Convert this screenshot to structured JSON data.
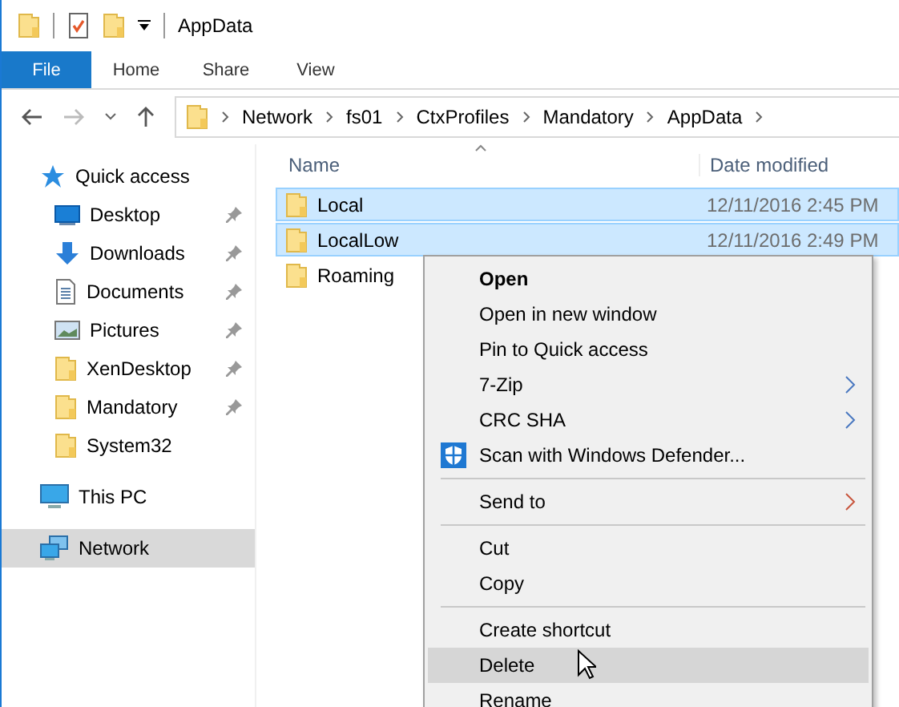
{
  "window": {
    "title": "AppData"
  },
  "ribbon_tabs": [
    {
      "label": "File",
      "selected": true
    },
    {
      "label": "Home",
      "selected": false
    },
    {
      "label": "Share",
      "selected": false
    },
    {
      "label": "View",
      "selected": false
    }
  ],
  "address_bar": {
    "path": [
      "Network",
      "fs01",
      "CtxProfiles",
      "Mandatory",
      "AppData"
    ]
  },
  "sidebar": {
    "items": [
      {
        "label": "Quick access",
        "kind": "star",
        "pinned": false,
        "selected": false
      },
      {
        "label": "Desktop",
        "kind": "desktop",
        "pinned": true,
        "selected": false
      },
      {
        "label": "Downloads",
        "kind": "download",
        "pinned": true,
        "selected": false
      },
      {
        "label": "Documents",
        "kind": "document",
        "pinned": true,
        "selected": false
      },
      {
        "label": "Pictures",
        "kind": "pictures",
        "pinned": true,
        "selected": false
      },
      {
        "label": "XenDesktop",
        "kind": "folder",
        "pinned": true,
        "selected": false
      },
      {
        "label": "Mandatory",
        "kind": "folder",
        "pinned": true,
        "selected": false
      },
      {
        "label": "System32",
        "kind": "folder",
        "pinned": false,
        "selected": false
      },
      {
        "label": "This PC",
        "kind": "pc",
        "pinned": false,
        "selected": false
      },
      {
        "label": "Network",
        "kind": "network",
        "pinned": false,
        "selected": true
      }
    ]
  },
  "file_list": {
    "columns": [
      "Name",
      "Date modified"
    ],
    "rows": [
      {
        "name": "Local",
        "date": "12/11/2016 2:45 PM",
        "selected": true
      },
      {
        "name": "LocalLow",
        "date": "12/11/2016 2:49 PM",
        "selected": true
      },
      {
        "name": "Roaming",
        "selected": false
      }
    ]
  },
  "context_menu": {
    "items": [
      {
        "kind": "item",
        "label": "Open",
        "default": true,
        "submenu": false,
        "selected": false
      },
      {
        "kind": "item",
        "label": "Open in new window",
        "default": false,
        "submenu": false,
        "selected": false
      },
      {
        "kind": "item",
        "label": "Pin to Quick access",
        "default": false,
        "submenu": false,
        "selected": false
      },
      {
        "kind": "item",
        "label": "7-Zip",
        "default": false,
        "submenu": true,
        "selected": false
      },
      {
        "kind": "item",
        "label": "CRC SHA",
        "default": false,
        "submenu": true,
        "selected": false
      },
      {
        "kind": "defender",
        "label": "Scan with Windows Defender...",
        "default": false,
        "submenu": false,
        "selected": false
      },
      {
        "kind": "separator"
      },
      {
        "kind": "item",
        "label": "Send to",
        "default": false,
        "submenu": true,
        "selected": false
      },
      {
        "kind": "separator"
      },
      {
        "kind": "item",
        "label": "Cut",
        "default": false,
        "submenu": false,
        "selected": false
      },
      {
        "kind": "item",
        "label": "Copy",
        "default": false,
        "submenu": false,
        "selected": false
      },
      {
        "kind": "separator"
      },
      {
        "kind": "item",
        "label": "Create shortcut",
        "default": false,
        "submenu": false,
        "selected": false
      },
      {
        "kind": "item",
        "label": "Delete",
        "default": false,
        "submenu": false,
        "selected": true
      },
      {
        "kind": "item",
        "label": "Rename",
        "default": false,
        "submenu": false,
        "selected": false
      }
    ]
  }
}
